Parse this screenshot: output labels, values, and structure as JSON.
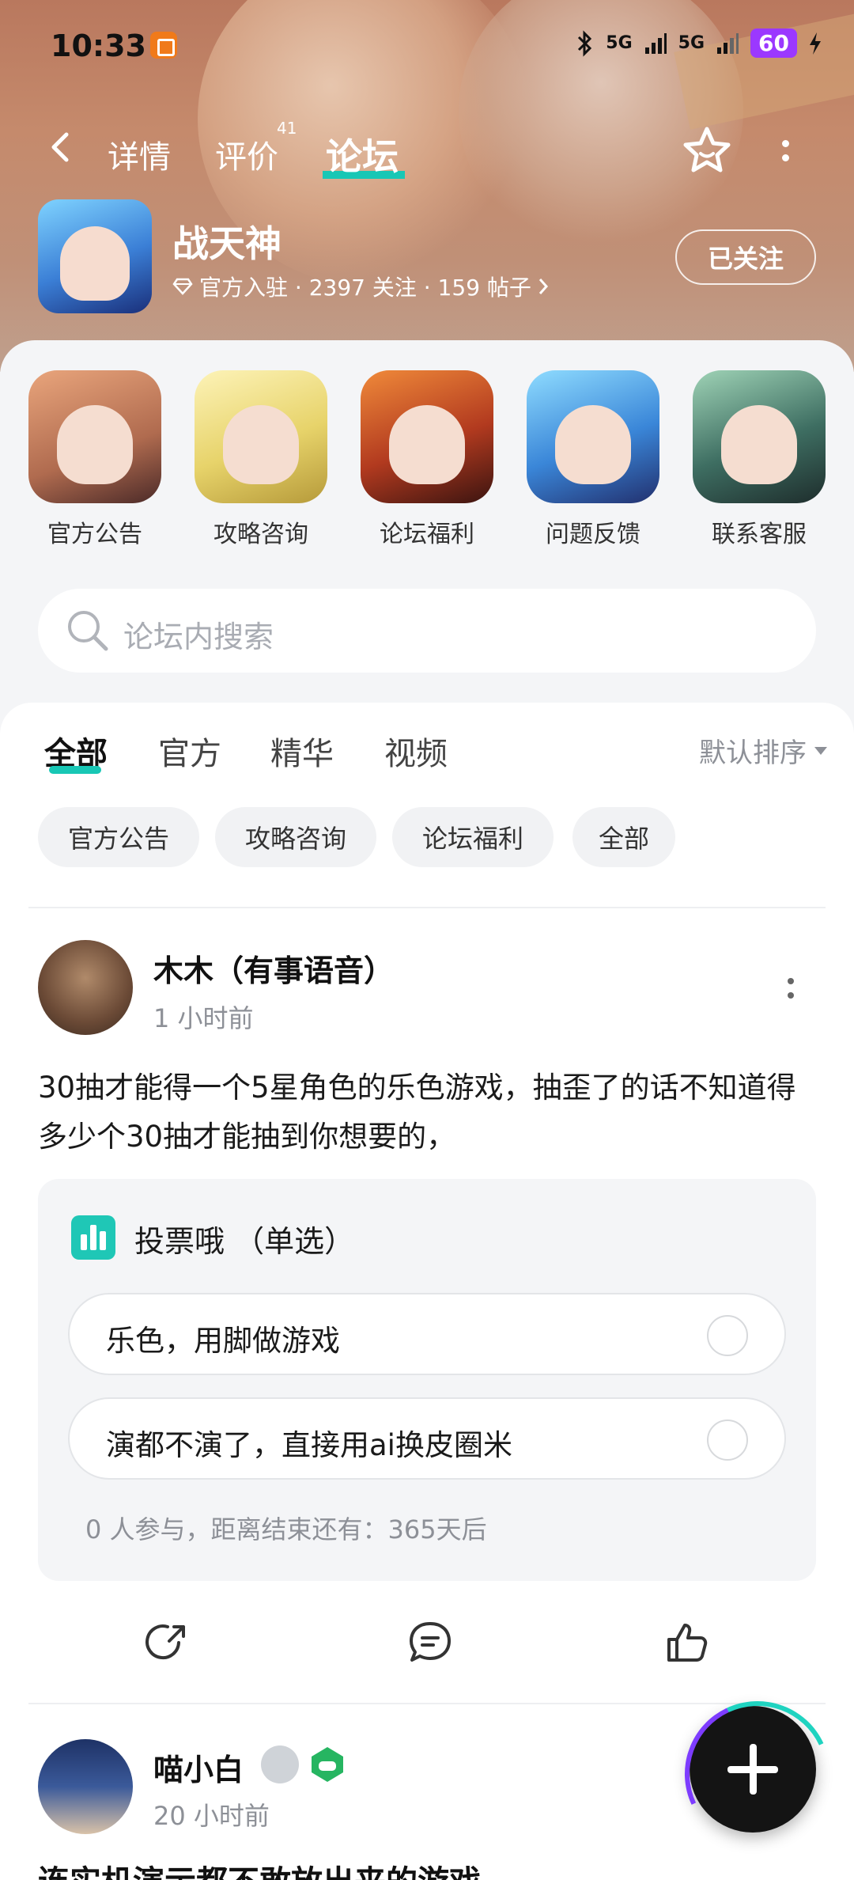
{
  "status_bar": {
    "time": "10:33",
    "net1": "5G",
    "net2": "5G",
    "battery": "60"
  },
  "nav": {
    "tabs": [
      {
        "label": "详情"
      },
      {
        "label": "评价",
        "badge": "41"
      },
      {
        "label": "论坛"
      }
    ],
    "active_tab": "论坛"
  },
  "game": {
    "name": "战天神",
    "meta": "官方入驻 · 2397 关注 · 159 帖子",
    "follow_label": "已关注"
  },
  "quick_links": [
    {
      "label": "官方公告"
    },
    {
      "label": "攻略咨询"
    },
    {
      "label": "论坛福利"
    },
    {
      "label": "问题反馈"
    },
    {
      "label": "联系客服"
    }
  ],
  "search": {
    "placeholder": "论坛内搜索"
  },
  "feed": {
    "tabs": [
      "全部",
      "官方",
      "精华",
      "视频"
    ],
    "sort_label": "默认排序",
    "chips": [
      "官方公告",
      "攻略咨询",
      "论坛福利",
      "全部"
    ]
  },
  "post1": {
    "author": "木木（有事语音）",
    "time": "1 小时前",
    "text": "30抽才能得一个5星角色的乐色游戏，抽歪了的话不知道得多少个30抽才能抽到你想要的，",
    "vote": {
      "title": "投票哦 （单选）",
      "options": [
        "乐色，用脚做游戏",
        "演都不演了，直接用ai换皮圈米"
      ],
      "footer": "0 人参与，距离结束还有：365天后"
    }
  },
  "post2": {
    "author": "喵小白",
    "time": "20 小时前",
    "title_partial": "连实机演示都不敢放出来的游戏"
  },
  "colors": {
    "accent": "#18c7b5",
    "fab": "#141414"
  }
}
